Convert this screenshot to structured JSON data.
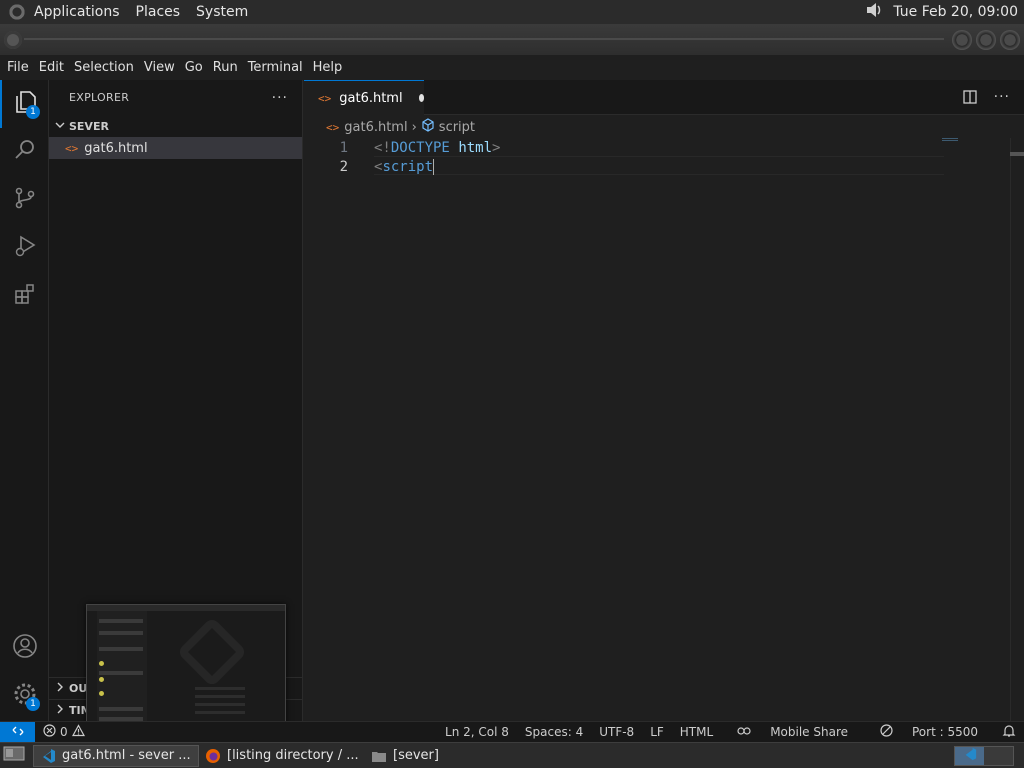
{
  "top_panel": {
    "menus": [
      "Applications",
      "Places",
      "System"
    ],
    "clock": "Tue Feb 20, 09:00"
  },
  "menubar": [
    "File",
    "Edit",
    "Selection",
    "View",
    "Go",
    "Run",
    "Terminal",
    "Help"
  ],
  "activity": {
    "explorer_badge": "1",
    "settings_badge": "1"
  },
  "sidebar": {
    "title": "EXPLORER",
    "more": "···",
    "folder": "SEVER",
    "file": "gat6.html",
    "outline_label": "OUTLINE",
    "timeline_label": "TIMELINE",
    "outline_visible": "OU",
    "timeline_visible": "TIM"
  },
  "tab": {
    "label": "gat6.html"
  },
  "breadcrumb": {
    "file": "gat6.html",
    "symbol": "script"
  },
  "editor": {
    "lines": [
      {
        "num": "1",
        "text_a": "<!",
        "kw": "DOCTYPE",
        "text_b": " ",
        "attr": "html",
        "text_c": ">"
      },
      {
        "num": "2",
        "text_a": "<",
        "kw": "script",
        "text_b": "",
        "attr": "",
        "text_c": ""
      }
    ]
  },
  "statusbar": {
    "errors": "0",
    "position": "Ln 2, Col 8",
    "spaces": "Spaces: 4",
    "encoding": "UTF-8",
    "eol": "LF",
    "language": "HTML",
    "mobile_share": "Mobile Share",
    "port": "Port : 5500"
  },
  "taskbar": {
    "items": [
      "gat6.html - sever ...",
      "[listing directory / ...",
      "[sever]"
    ]
  },
  "colors": {
    "accent": "#0078d4",
    "html_icon": "#e37933"
  }
}
